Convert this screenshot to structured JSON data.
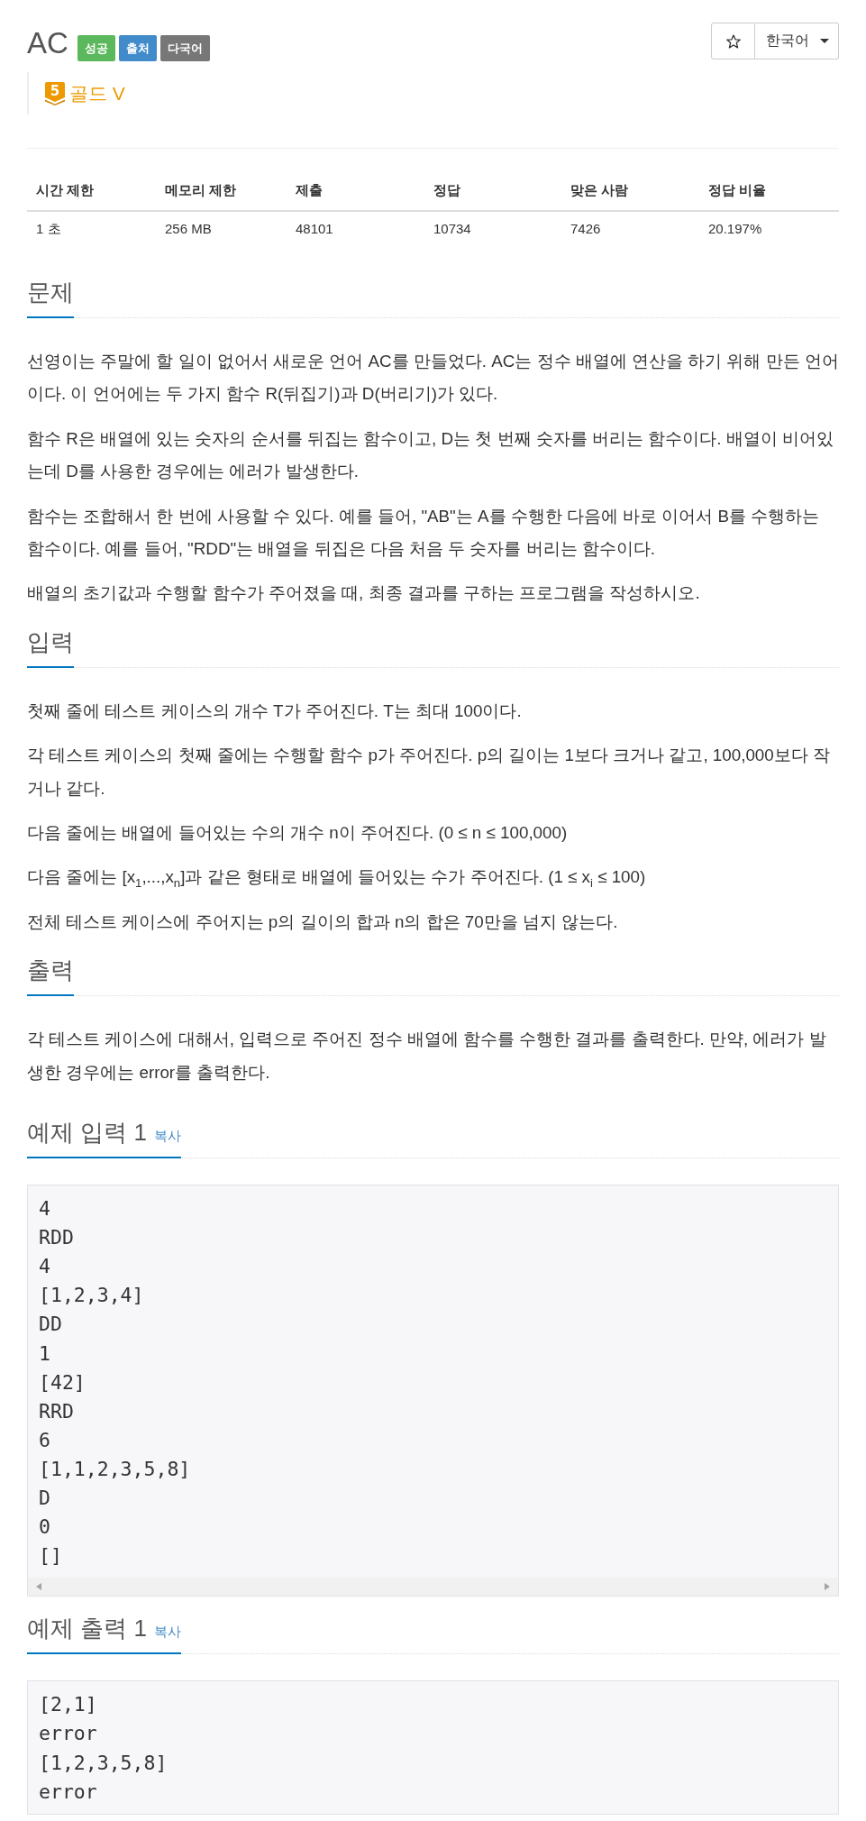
{
  "problem": {
    "title": "AC",
    "tags": [
      {
        "text": "성공",
        "color": "#5cb85c"
      },
      {
        "text": "출처",
        "color": "#428bca"
      },
      {
        "text": "다국어",
        "color": "#777777"
      }
    ]
  },
  "toolbar": {
    "starred": false,
    "language": "한국어"
  },
  "tier": {
    "badge": "5",
    "name": "골드 V"
  },
  "limits": {
    "columns": [
      "시간 제한",
      "메모리 제한",
      "제출",
      "정답",
      "맞은 사람",
      "정답 비율"
    ],
    "rows": [
      [
        "1 초",
        "256 MB",
        "48101",
        "10734",
        "7426",
        "20.197%"
      ]
    ]
  },
  "sections": [
    {
      "kind": "text",
      "title": "문제",
      "paragraphs": [
        "선영이는 주말에 할 일이 없어서 새로운 언어 AC를 만들었다. AC는 정수 배열에 연산을 하기 위해 만든 언어이다. 이 언어에는 두 가지 함수 R(뒤집기)과 D(버리기)가 있다.",
        "함수 R은 배열에 있는 숫자의 순서를 뒤집는 함수이고, D는 첫 번째 숫자를 버리는 함수이다. 배열이 비어있는데 D를 사용한 경우에는 에러가 발생한다.",
        "함수는 조합해서 한 번에 사용할 수 있다. 예를 들어, \"AB\"는 A를 수행한 다음에 바로 이어서 B를 수행하는 함수이다. 예를 들어, \"RDD\"는 배열을 뒤집은 다음 처음 두 숫자를 버리는 함수이다.",
        "배열의 초기값과 수행할 함수가 주어졌을 때, 최종 결과를 구하는 프로그램을 작성하시오."
      ]
    },
    {
      "kind": "text",
      "title": "입력",
      "paragraphs": [
        "첫째 줄에 테스트 케이스의 개수 T가 주어진다. T는 최대 100이다.",
        "각 테스트 케이스의 첫째 줄에는 수행할 함수 p가 주어진다. p의 길이는 1보다 크거나 같고, 100,000보다 작거나 같다.",
        "다음 줄에는 배열에 들어있는 수의 개수 n이 주어진다. (0 ≤ n ≤ 100,000)",
        "다음 줄에는 [x$_{1}$,...,x$_{n}$]과 같은 형태로 배열에 들어있는 수가 주어진다. (1 ≤ x$_{i}$ ≤ 100)",
        "전체 테스트 케이스에 주어지는 p의 길이의 합과 n의 합은 70만을 넘지 않는다."
      ]
    },
    {
      "kind": "text",
      "title": "출력",
      "paragraphs": [
        "각 테스트 케이스에 대해서, 입력으로 주어진 정수 배열에 함수를 수행한 결과를 출력한다. 만약, 에러가 발생한 경우에는 error를 출력한다."
      ]
    },
    {
      "kind": "sample",
      "title": "예제 입력 1",
      "copy": "복사",
      "lines": [
        "4",
        "RDD",
        "4",
        "[1,2,3,4]",
        "DD",
        "1",
        "[42]",
        "RRD",
        "6",
        "[1,1,2,3,5,8]",
        "D",
        "0",
        "[]"
      ],
      "scrollbar": true
    },
    {
      "kind": "sample",
      "title": "예제 출력 1",
      "copy": "복사",
      "lines": [
        "[2,1]",
        "error",
        "[1,2,3,5,8]",
        "error"
      ],
      "scrollbar": false
    }
  ]
}
